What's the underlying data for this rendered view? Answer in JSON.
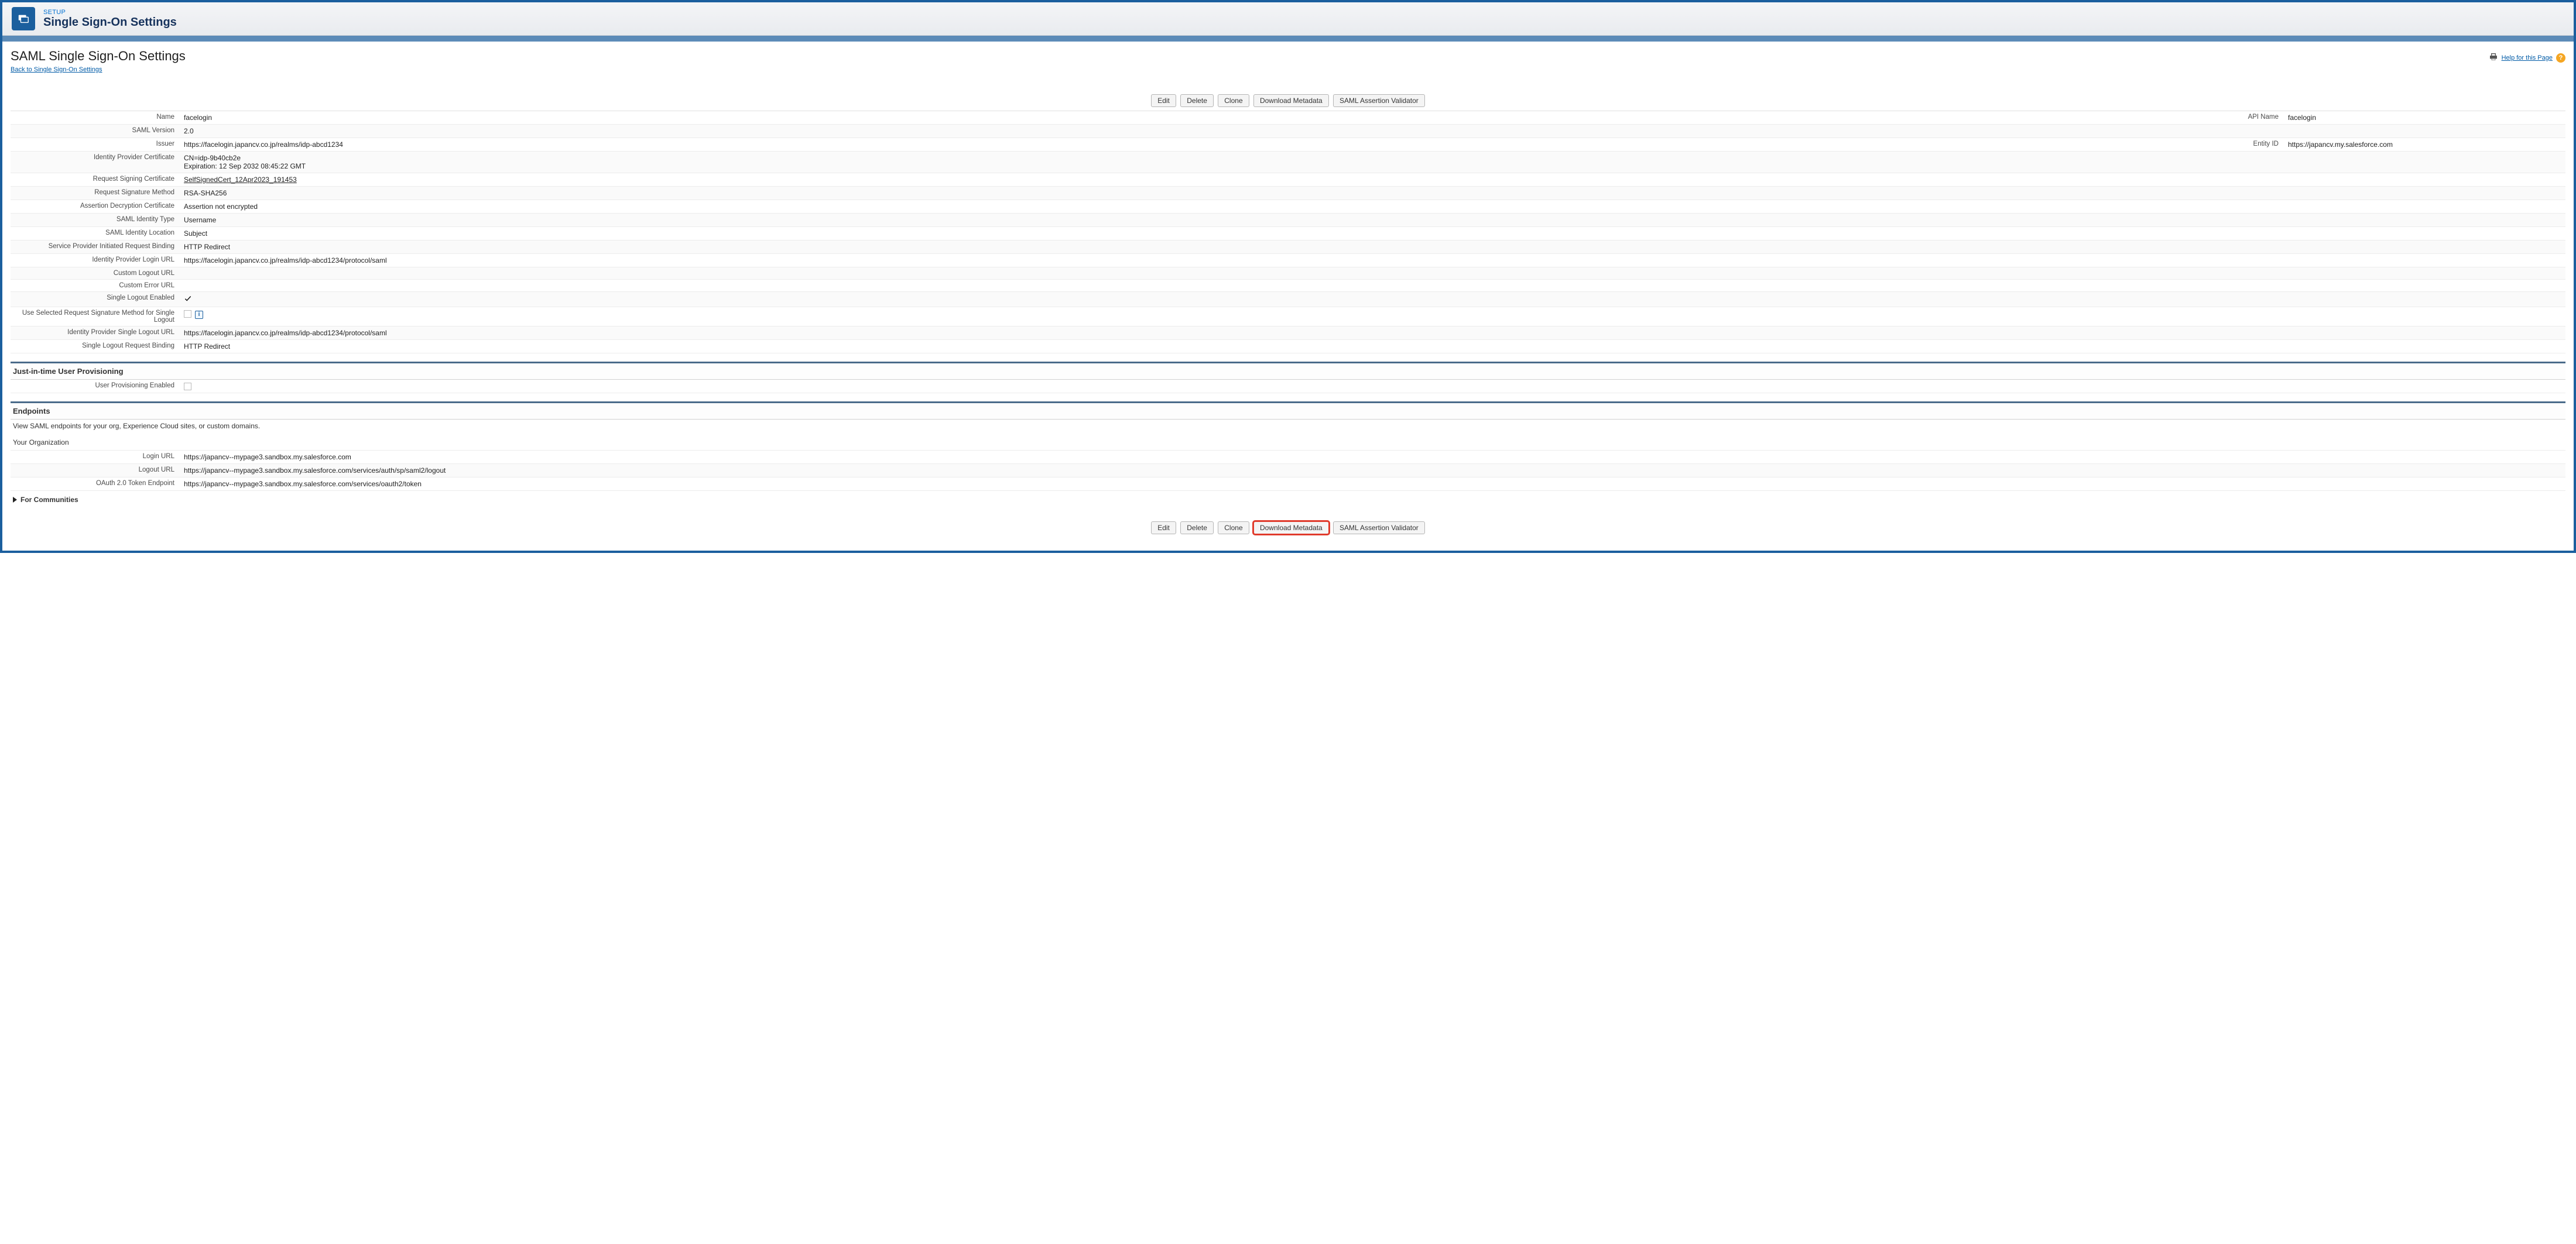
{
  "header": {
    "breadcrumb": "SETUP",
    "title": "Single Sign-On Settings"
  },
  "page": {
    "title": "SAML Single Sign-On Settings",
    "back_link": "Back to Single Sign-On Settings",
    "help_link": "Help for this Page"
  },
  "buttons": {
    "edit": "Edit",
    "delete": "Delete",
    "clone": "Clone",
    "download_metadata": "Download Metadata",
    "saml_validator": "SAML Assertion Validator"
  },
  "details": {
    "rows": [
      {
        "label": "Name",
        "value": "facelogin",
        "right_label": "API Name",
        "right_value": "facelogin"
      },
      {
        "label": "SAML Version",
        "value": "2.0"
      },
      {
        "label": "Issuer",
        "value": "https://facelogin.japancv.co.jp/realms/idp-abcd1234",
        "right_label": "Entity ID",
        "right_value": "https://japancv.my.salesforce.com"
      },
      {
        "label": "Identity Provider Certificate",
        "value": "CN=idp-9b40cb2e\nExpiration: 12 Sep 2032 08:45:22 GMT"
      },
      {
        "label": "Request Signing Certificate",
        "value_link": "SelfSignedCert_12Apr2023_191453"
      },
      {
        "label": "Request Signature Method",
        "value": "RSA-SHA256"
      },
      {
        "label": "Assertion Decryption Certificate",
        "value": "Assertion not encrypted"
      },
      {
        "label": "SAML Identity Type",
        "value": "Username"
      },
      {
        "label": "SAML Identity Location",
        "value": "Subject"
      },
      {
        "label": "Service Provider Initiated Request Binding",
        "value": "HTTP Redirect"
      },
      {
        "label": "Identity Provider Login URL",
        "value": "https://facelogin.japancv.co.jp/realms/idp-abcd1234/protocol/saml"
      },
      {
        "label": "Custom Logout URL",
        "value": ""
      },
      {
        "label": "Custom Error URL",
        "value": ""
      },
      {
        "label": "Single Logout Enabled",
        "checked": true
      },
      {
        "label": "Use Selected Request Signature Method for Single Logout",
        "checkbox_unchecked": true,
        "info": true
      },
      {
        "label": "Identity Provider Single Logout URL",
        "value": "https://facelogin.japancv.co.jp/realms/idp-abcd1234/protocol/saml"
      },
      {
        "label": "Single Logout Request Binding",
        "value": "HTTP Redirect"
      }
    ]
  },
  "jit": {
    "header": "Just-in-time User Provisioning",
    "row_label": "User Provisioning Enabled"
  },
  "endpoints": {
    "header": "Endpoints",
    "desc": "View SAML endpoints for your org, Experience Cloud sites, or custom domains.",
    "org_header": "Your Organization",
    "rows": [
      {
        "label": "Login URL",
        "value": "https://japancv--mypage3.sandbox.my.salesforce.com"
      },
      {
        "label": "Logout URL",
        "value": "https://japancv--mypage3.sandbox.my.salesforce.com/services/auth/sp/saml2/logout"
      },
      {
        "label": "OAuth 2.0 Token Endpoint",
        "value": "https://japancv--mypage3.sandbox.my.salesforce.com/services/oauth2/token"
      }
    ],
    "communities_expander": "For Communities"
  }
}
